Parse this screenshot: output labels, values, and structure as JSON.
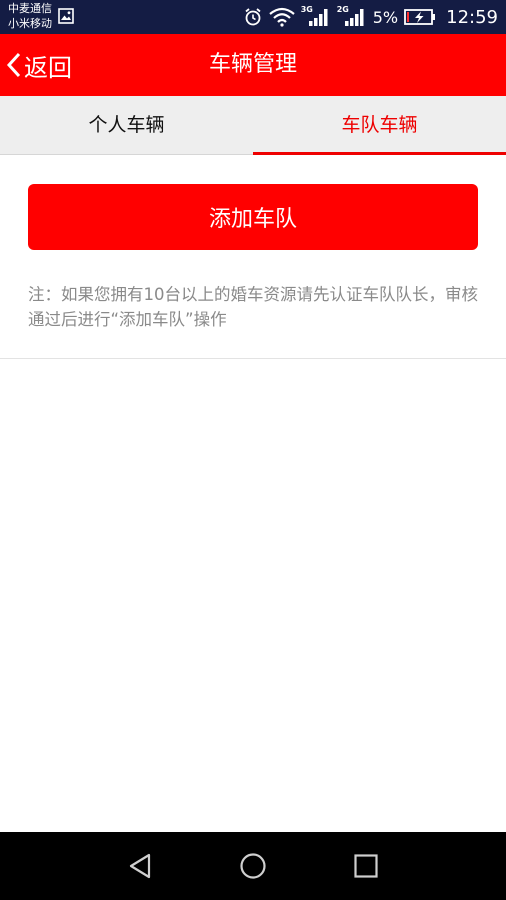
{
  "status_bar": {
    "carrier_1": "中麦通信",
    "carrier_2": "小米移动",
    "net_1": "3G",
    "net_2": "2G",
    "battery_percent": "5%",
    "time": "12:59",
    "icons": [
      "gallery-icon",
      "alarm-icon",
      "wifi-icon",
      "signal-icon",
      "battery-charging-icon"
    ]
  },
  "app_bar": {
    "back_label": "返回",
    "title": "车辆管理"
  },
  "tabs": [
    {
      "label": "个人车辆",
      "active": false
    },
    {
      "label": "车队车辆",
      "active": true
    }
  ],
  "content": {
    "add_button_label": "添加车队",
    "note": "注：如果您拥有10台以上的婚车资源请先认证车队队长，审核通过后进行“添加车队”操作"
  },
  "colors": {
    "accent": "#ff0000",
    "status_bar_bg": "#141c44",
    "tab_bar_bg": "#eeeeee",
    "note_text": "#8a8a8a"
  },
  "nav_bar": {
    "icons": [
      "nav-back-icon",
      "nav-home-icon",
      "nav-recent-icon"
    ]
  }
}
